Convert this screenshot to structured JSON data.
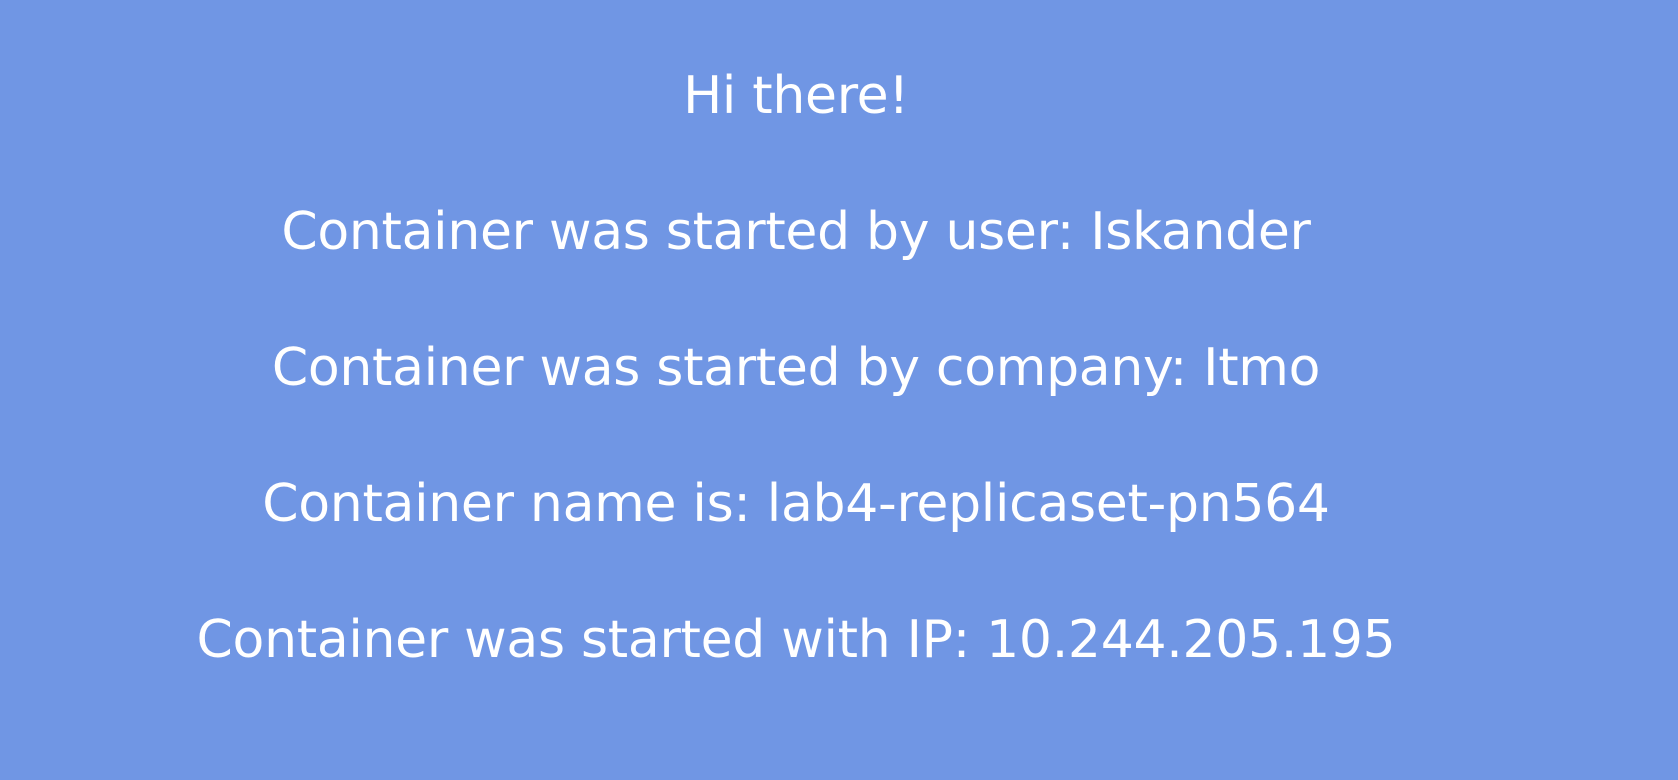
{
  "colors": {
    "background": "#7096e4",
    "text": "#ffffff"
  },
  "greeting": "Hi there!",
  "lines": {
    "user": "Container was started by user: Iskander",
    "company": "Container was started by company: Itmo",
    "name": "Container name is: lab4-replicaset-pn564",
    "ip": "Container was started with IP: 10.244.205.195"
  }
}
